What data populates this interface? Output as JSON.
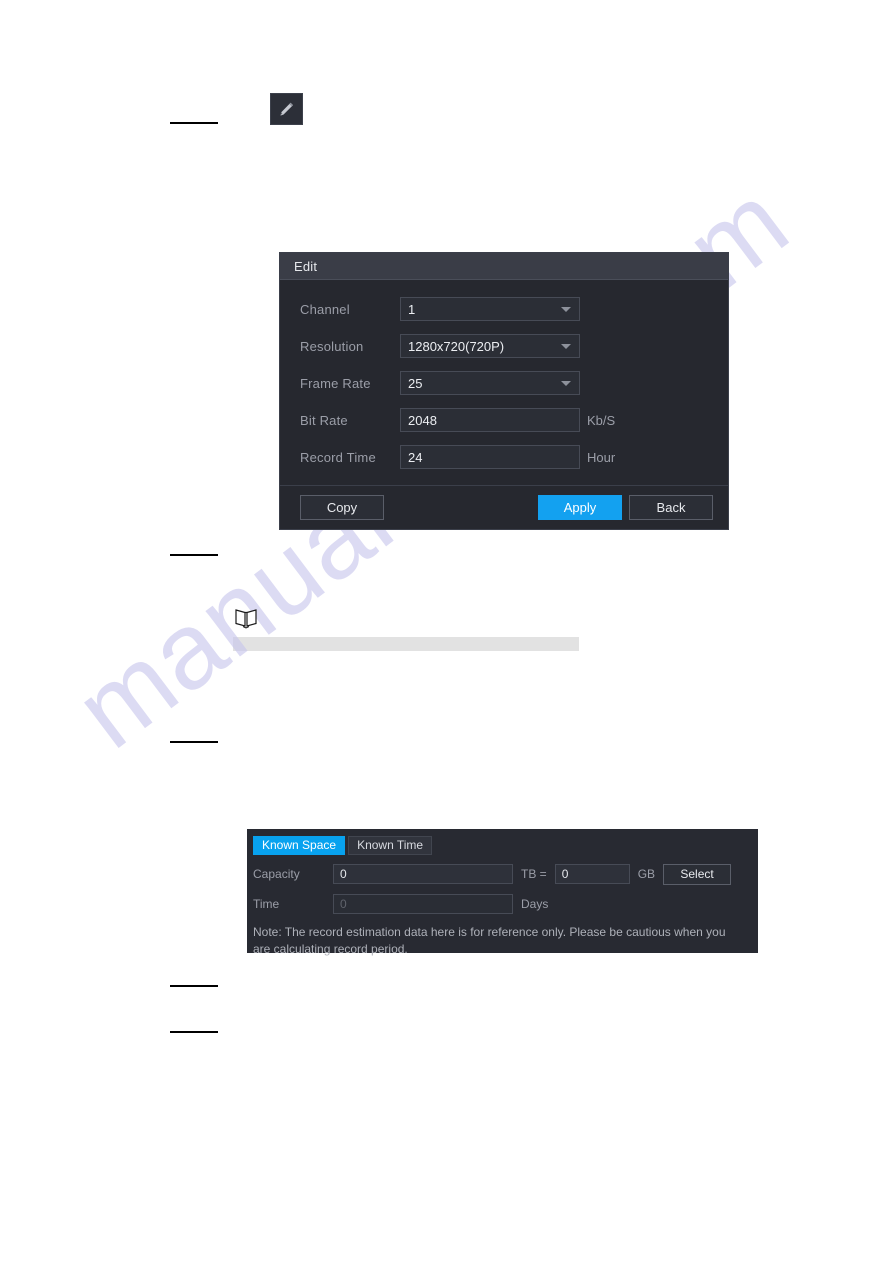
{
  "page": {
    "watermark": "manualshive.com"
  },
  "pencil_button": {
    "icon": "pencil-icon"
  },
  "note": {
    "icon": "book-note-icon"
  },
  "edit_dialog": {
    "title": "Edit",
    "fields": [
      {
        "label": "Channel",
        "value": "1",
        "control": "dropdown",
        "unit": ""
      },
      {
        "label": "Resolution",
        "value": "1280x720(720P)",
        "control": "dropdown",
        "unit": ""
      },
      {
        "label": "Frame Rate",
        "value": "25",
        "control": "dropdown",
        "unit": ""
      },
      {
        "label": "Bit Rate",
        "value": "2048",
        "control": "text",
        "unit": "Kb/S"
      },
      {
        "label": "Record Time",
        "value": "24",
        "control": "text",
        "unit": "Hour"
      }
    ],
    "buttons": {
      "copy": "Copy",
      "apply": "Apply",
      "back": "Back"
    },
    "accent_color": "#13a1f0"
  },
  "estimate_panel": {
    "tabs": [
      {
        "label": "Known Space",
        "active": true
      },
      {
        "label": "Known Time",
        "active": false
      }
    ],
    "capacity": {
      "label": "Capacity",
      "value_tb": "0",
      "unit_tb": "TB =",
      "value_gb": "0",
      "unit_gb": "GB",
      "select_button": "Select"
    },
    "time": {
      "label": "Time",
      "value": "0",
      "unit": "Days"
    },
    "note": "Note: The record estimation data here is for reference only. Please be cautious when you are calculating record period.",
    "accent_color": "#08a2ef"
  }
}
